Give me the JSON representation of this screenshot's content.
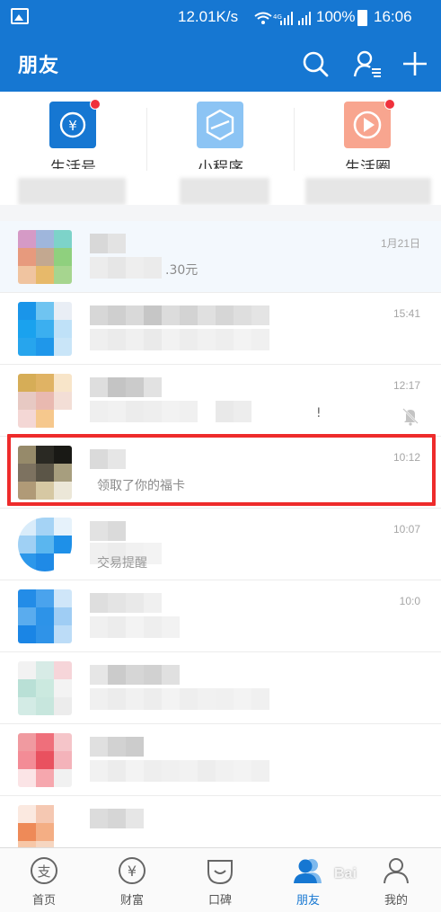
{
  "status_bar": {
    "speed": "12.01K/s",
    "battery": "100%",
    "time": "16:06"
  },
  "header": {
    "title": "朋友",
    "icons": [
      "search-icon",
      "add-contact-icon",
      "plus-icon"
    ],
    "background": "#1677d2"
  },
  "shortcuts": [
    {
      "label": "生活号",
      "icon": "life-account-icon",
      "color": "#1677d2",
      "has_dot": true
    },
    {
      "label": "小程序",
      "icon": "mini-program-icon",
      "color": "#8cc4f4",
      "has_dot": false
    },
    {
      "label": "生活圈",
      "icon": "life-circle-icon",
      "color": "#f8a58f",
      "has_dot": true
    }
  ],
  "conversations": [
    {
      "time": "1月21日",
      "preview": ".30元",
      "pinned": true,
      "muted": false
    },
    {
      "time": "15:41",
      "preview": "",
      "pinned": false,
      "muted": false
    },
    {
      "time": "12:17",
      "preview": "!",
      "pinned": false,
      "muted": true
    },
    {
      "time": "10:12",
      "preview": "领取了你的福卡",
      "pinned": false,
      "muted": false,
      "highlighted": true
    },
    {
      "time": "10:07",
      "preview": "交易提醒",
      "pinned": false,
      "muted": false
    },
    {
      "time": "10:0",
      "preview": "",
      "pinned": false,
      "muted": false
    },
    {
      "time": "",
      "preview": "",
      "pinned": false,
      "muted": false
    },
    {
      "time": "",
      "preview": "",
      "pinned": false,
      "muted": false
    },
    {
      "time": "",
      "preview": "",
      "pinned": false,
      "muted": false
    }
  ],
  "bottom_nav": [
    {
      "label": "首页",
      "icon": "home-icon",
      "active": false
    },
    {
      "label": "财富",
      "icon": "wealth-icon",
      "active": false
    },
    {
      "label": "口碑",
      "icon": "koubei-icon",
      "active": false
    },
    {
      "label": "朋友",
      "icon": "friends-icon",
      "active": true
    },
    {
      "label": "我的",
      "icon": "profile-icon",
      "active": false
    }
  ],
  "watermark": "Bai"
}
